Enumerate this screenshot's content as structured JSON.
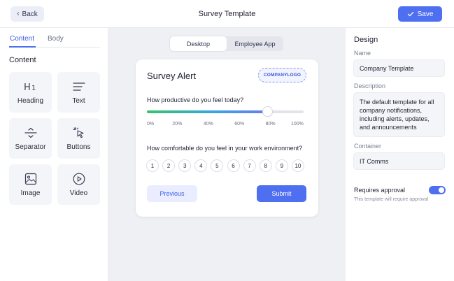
{
  "header": {
    "back_label": "Back",
    "title": "Survey Template",
    "save_label": "Save"
  },
  "left_panel": {
    "tabs": [
      {
        "label": "Content",
        "active": true
      },
      {
        "label": "Body",
        "active": false
      }
    ],
    "section_title": "Content",
    "blocks": [
      {
        "label": "Heading",
        "icon": "heading-icon"
      },
      {
        "label": "Text",
        "icon": "text-lines-icon"
      },
      {
        "label": "Separator",
        "icon": "separator-icon"
      },
      {
        "label": "Buttons",
        "icon": "cursor-click-icon"
      },
      {
        "label": "Image",
        "icon": "image-icon"
      },
      {
        "label": "Video",
        "icon": "play-icon"
      }
    ]
  },
  "canvas": {
    "view_options": [
      {
        "label": "Desktop",
        "selected": true
      },
      {
        "label": "Employee App",
        "selected": false
      }
    ],
    "card": {
      "title": "Survey Alert",
      "logo_text": "COMPANYLOGO",
      "question1": "How productive do you feel today?",
      "slider_value": 0.77,
      "slider_ticks": [
        "0%",
        "20%",
        "40%",
        "60%",
        "80%",
        "100%"
      ],
      "question2": "How comfortable do you feel in your work environment?",
      "scale": [
        "1",
        "2",
        "3",
        "4",
        "5",
        "6",
        "7",
        "8",
        "9",
        "10"
      ],
      "previous_label": "Previous",
      "submit_label": "Submit"
    }
  },
  "design_panel": {
    "title": "Design",
    "name_label": "Name",
    "name_value": "Company Template",
    "description_label": "Description",
    "description_value": "The default template for all company notifications, including alerts, updates, and announcements",
    "container_label": "Container",
    "container_value": "IT Comms",
    "approval_label": "Requires approval",
    "approval_hint": "This template will require approval",
    "approval_enabled": true
  },
  "colors": {
    "accent": "#4f6ff1",
    "background": "#eef0f4"
  }
}
